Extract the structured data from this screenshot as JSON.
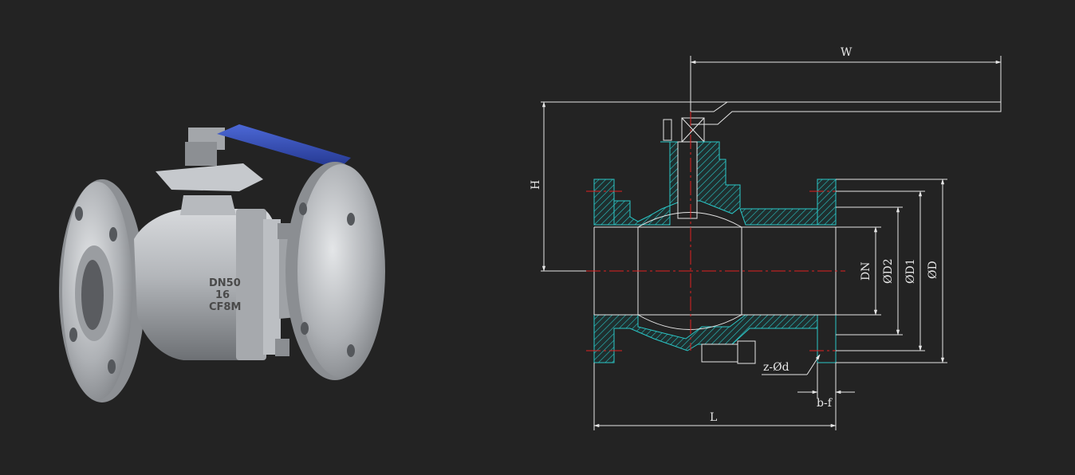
{
  "valve_body_marking": {
    "line1": "DN50",
    "line2": "16",
    "line3": "CF8M"
  },
  "dimension_labels": {
    "width": "W",
    "height": "H",
    "length": "L",
    "nominal_diameter": "DN",
    "diameter_d2": "ØD2",
    "diameter_d1": "ØD1",
    "outer_diameter": "ØD",
    "bolt_holes": "z-Ød",
    "flange_thickness": "b-f"
  },
  "colors": {
    "background": "#232323",
    "drawing_lines": "#e6e6e6",
    "section_hatch": "#2bc7c7",
    "center_lines": "#e02020",
    "handle": "#2f4bb5",
    "steel": "#b9bcc0"
  }
}
